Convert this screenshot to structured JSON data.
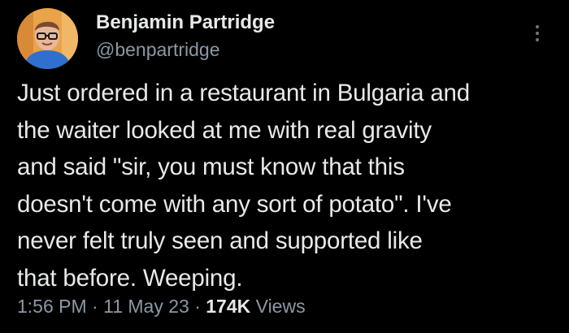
{
  "author": {
    "display_name": "Benjamin Partridge",
    "handle": "@benpartridge",
    "avatar_icon": "profile-photo"
  },
  "tweet": {
    "lines": [
      "Just ordered in a restaurant in Bulgaria and",
      "the waiter looked at me with real gravity",
      "and said \"sir, you must know that this",
      "doesn't come with any sort of potato\". I've",
      "never felt truly seen and supported like",
      "that before. Weeping."
    ]
  },
  "meta": {
    "time": "1:56 PM",
    "separator": " · ",
    "date": "11 May 23",
    "views_count": "174K",
    "views_label": " Views"
  },
  "menu": {
    "icon": "more-vertical-icon"
  },
  "colors": {
    "background": "#000000",
    "primary_text": "#e7e9ea",
    "secondary_text": "#8b98a5",
    "avatar_background": "#e9a34a"
  }
}
